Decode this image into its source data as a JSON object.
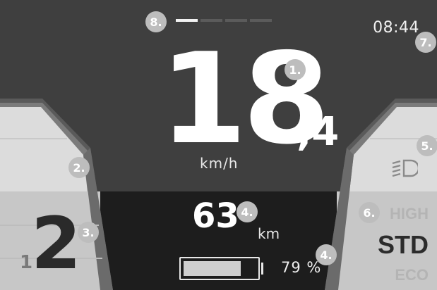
{
  "status_bar": {
    "page_indicator": {
      "count": 4,
      "active_index": 0
    },
    "clock": "08:44"
  },
  "speed": {
    "integer": "18",
    "decimal": ",4",
    "unit": "km/h"
  },
  "assist": {
    "level_large": "2",
    "level_small": "1"
  },
  "range": {
    "value": "63",
    "unit": "km"
  },
  "battery": {
    "percent_text": "79 %",
    "level": 0.79
  },
  "light": {
    "icon": "headlight-icon"
  },
  "modes": {
    "high": "HIGH",
    "std": "STD",
    "eco": "ECO",
    "selected": "STD"
  },
  "markers": {
    "m1": "1.",
    "m2": "2.",
    "m3": "3.",
    "m4a": "4.",
    "m4b": "4.",
    "m5": "5.",
    "m6": "6.",
    "m7": "7.",
    "m8": "8."
  },
  "colors": {
    "background": "#3f3f3f",
    "lower_area": "#1d1d1d",
    "panel_light": "#d9d9d9",
    "text": "#ffffff",
    "marker": "#bdbdbd"
  }
}
